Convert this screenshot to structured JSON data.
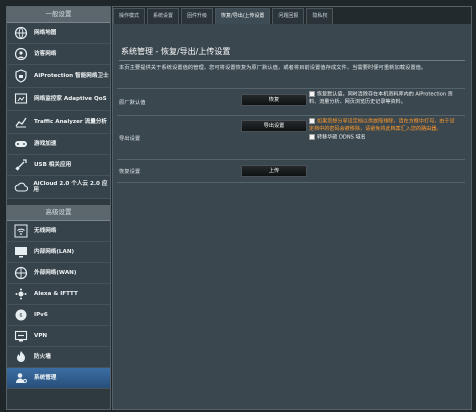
{
  "sidebar": {
    "section1_title": "一般设置",
    "section2_title": "高级设置",
    "items1": [
      {
        "label": "网络地图"
      },
      {
        "label": "访客网络"
      },
      {
        "label": "AiProtection 智能网络卫士"
      },
      {
        "label": "网络监控家 Adaptive QoS"
      },
      {
        "label": "Traffic Analyzer 流量分析"
      },
      {
        "label": "游戏加速"
      },
      {
        "label": "USB 相关应用"
      },
      {
        "label": "AiCloud 2.0 个人云 2.0 应用"
      }
    ],
    "items2": [
      {
        "label": "无线网络"
      },
      {
        "label": "内部网络(LAN)"
      },
      {
        "label": "外部网络(WAN)"
      },
      {
        "label": "Alexa & IFTTT"
      },
      {
        "label": "IPv6"
      },
      {
        "label": "VPN"
      },
      {
        "label": "防火墙"
      },
      {
        "label": "系统管理"
      }
    ]
  },
  "tabs": [
    "操作模式",
    "系统设置",
    "固件升级",
    "恢复/导出/上传设置",
    "问题回报",
    "隐私权"
  ],
  "page": {
    "title": "系统管理 - 恢复/导出/上传设置",
    "description": "本页主要提供关于系统设置值的管理，您可将设置恢复为原厂默认值，或者将目前设置值存成文件，当需要时便可重新加载设置值。",
    "rows": [
      {
        "label": "原厂默认值",
        "button": "恢复",
        "option": "恢复默认值，同时清除存在本机资料库内的 AiProtection 资料、流量分析、网页浏览历史记录等资料。"
      },
      {
        "label": "导出设置",
        "button": "导出设置",
        "option": "如果您想分享设定档以供故障排除，请在方框中打勾，由于设定档中的密码会被移除，请避免将此档案汇入您的路由器。",
        "option2": "转移华硕 DDNS 域名"
      },
      {
        "label": "恢复设置",
        "button": "上传"
      }
    ]
  },
  "colors": {
    "accent": "#3c6ea3",
    "highlight": "#ff9a2b"
  }
}
